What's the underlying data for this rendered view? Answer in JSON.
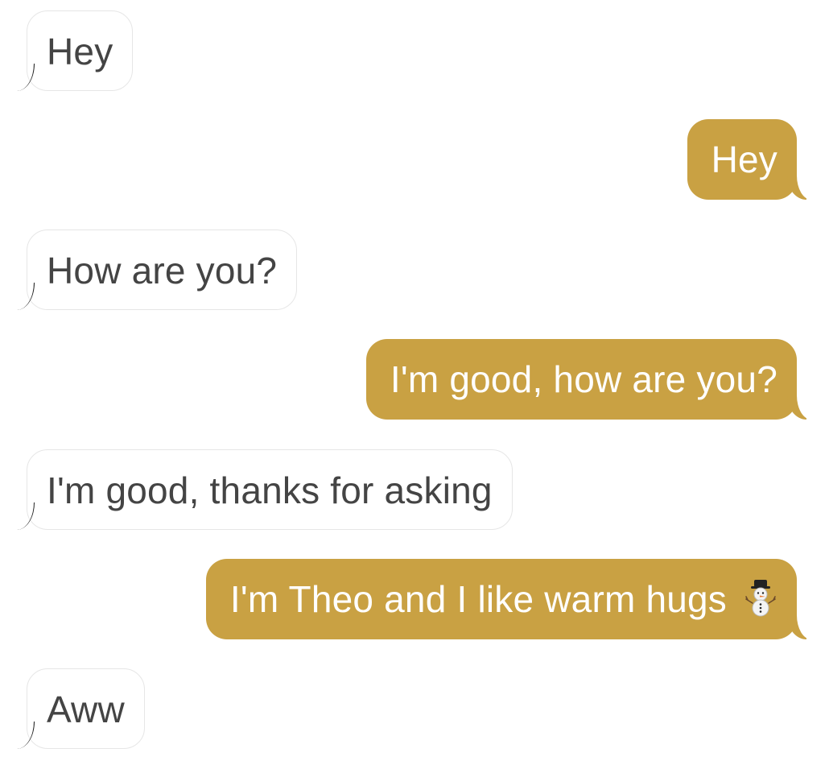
{
  "messages": [
    {
      "side": "received",
      "text": "Hey"
    },
    {
      "side": "sent",
      "text": "Hey"
    },
    {
      "side": "received",
      "text": "How are you?"
    },
    {
      "side": "sent",
      "text": "I'm good, how are you?"
    },
    {
      "side": "received",
      "text": "I'm good, thanks for asking"
    },
    {
      "side": "sent",
      "text": "I'm Theo and I like warm hugs",
      "emoji": "snowman-icon"
    },
    {
      "side": "received",
      "text": "Aww"
    }
  ],
  "colors": {
    "sent_bubble": "#c9a143",
    "sent_text": "#ffffff",
    "received_bubble": "#ffffff",
    "received_text": "#444444"
  }
}
